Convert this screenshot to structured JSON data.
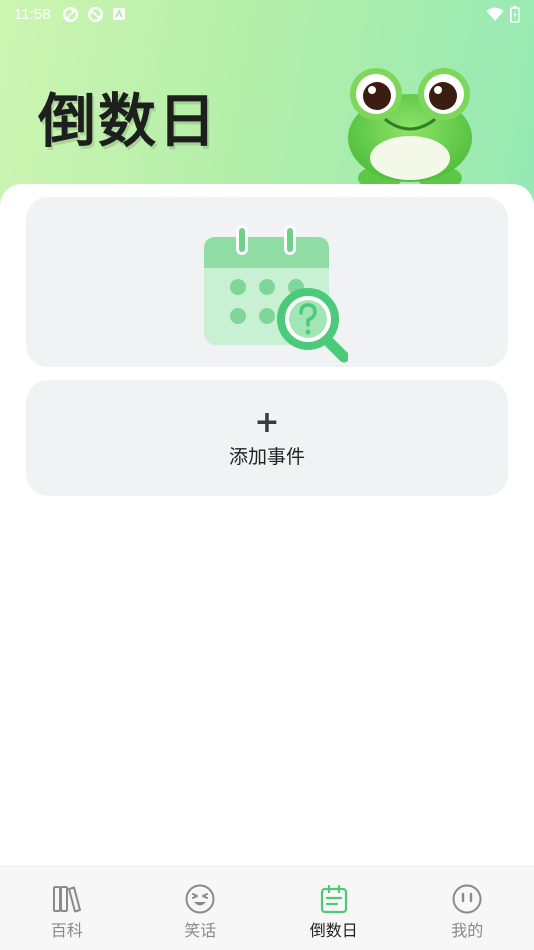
{
  "status_bar": {
    "time": "11:58",
    "left_icons": [
      "sync-icon",
      "sync-icon",
      "notification-icon"
    ],
    "right_icons": [
      "wifi-icon",
      "battery-icon"
    ]
  },
  "header": {
    "title": "倒数日",
    "mascot": "frog-mascot"
  },
  "empty_state": {
    "illustration": "calendar-search-icon"
  },
  "add_event": {
    "plus": "+",
    "label": "添加事件"
  },
  "bottom_nav": {
    "items": [
      {
        "label": "百科",
        "icon": "books-icon",
        "active": false
      },
      {
        "label": "笑话",
        "icon": "smiley-icon",
        "active": false
      },
      {
        "label": "倒数日",
        "icon": "calendar-icon",
        "active": true
      },
      {
        "label": "我的",
        "icon": "face-icon",
        "active": false
      }
    ]
  },
  "colors": {
    "accent": "#4cc97b",
    "header_gradient_start": "#cdf5b2",
    "header_gradient_end": "#95e9b4",
    "card_bg": "#f1f2f4"
  }
}
